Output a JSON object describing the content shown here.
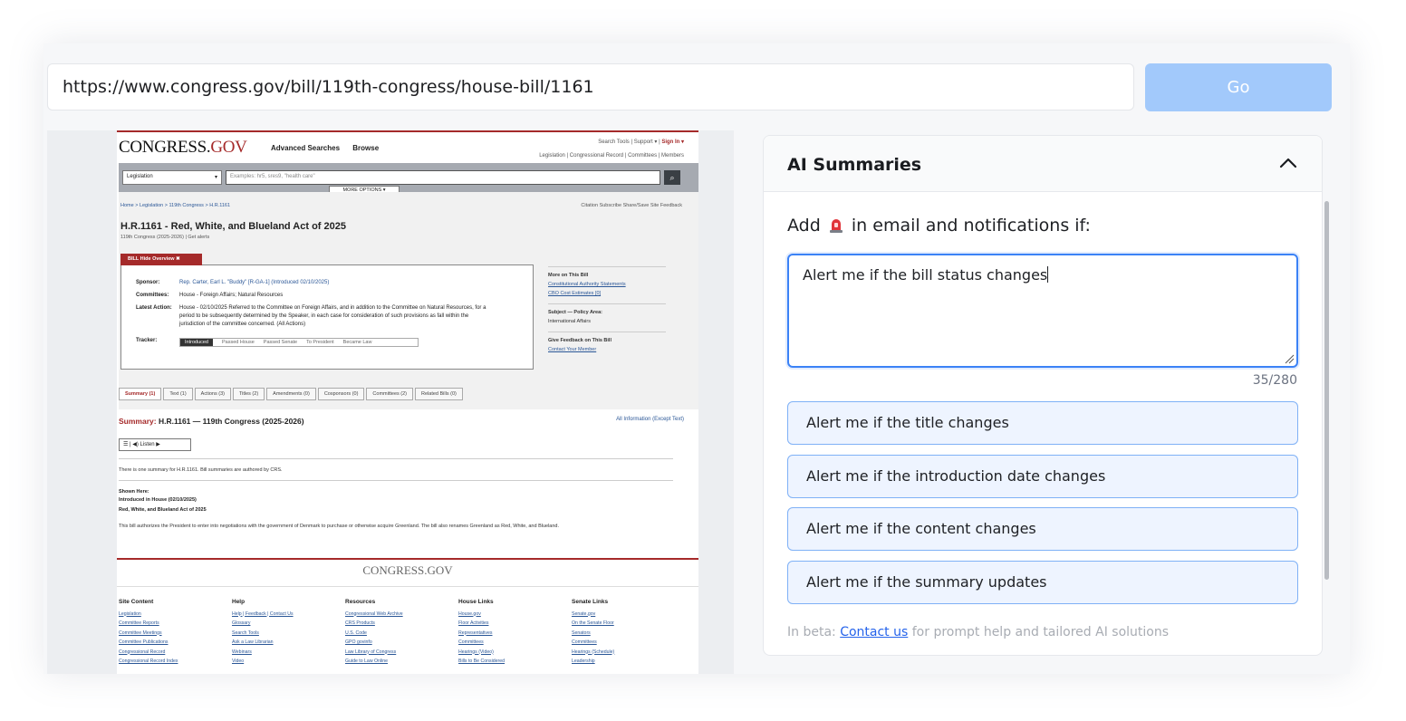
{
  "browser": {
    "url": "https://www.congress.gov/bill/119th-congress/house-bill/1161",
    "go_label": "Go"
  },
  "preview": {
    "logo": {
      "main": "CONGRESS.",
      "accent": "GOV"
    },
    "topnav": [
      "Advanced Searches",
      "Browse"
    ],
    "util_top": [
      "Search Tools",
      "Support ▾",
      "Sign In ▾"
    ],
    "util_bottom": [
      "Legislation",
      "Congressional Record",
      "Committees",
      "Members"
    ],
    "search_select": "Legislation",
    "search_placeholder": "Examples: hr5, sres9, \"health care\"",
    "more_options": "MORE OPTIONS ▾",
    "breadcrumb": "Home > Legislation > 119th Congress > H.R.1161",
    "tools": "Citation   Subscribe   Share/Save   Site Feedback",
    "bill_title": "H.R.1161 - Red, White, and Blueland Act of 2025",
    "bill_sub": "119th Congress (2025-2026) | Get alerts",
    "bill_tag": "BILL    Hide Overview ✖",
    "sponsor_label": "Sponsor:",
    "sponsor": "Rep. Carter, Earl L. \"Buddy\" [R-GA-1] (Introduced 02/10/2025)",
    "committees_label": "Committees:",
    "committees": "House - Foreign Affairs; Natural Resources",
    "latest_label": "Latest Action:",
    "latest_1": "House - 02/10/2025 Referred to the Committee on Foreign Affairs, and in addition to the Committee on Natural Resources, for a",
    "latest_2": "period to be subsequently determined by the Speaker, in each case for consideration of such provisions as fall within the",
    "latest_3": "jurisdiction of the committee concerned.  (All Actions)",
    "tracker_label": "Tracker:",
    "tracker_steps": [
      "Introduced",
      "Passed House",
      "Passed Senate",
      "To President",
      "Became Law"
    ],
    "right_more": "More on This Bill",
    "right_link1": "Constitutional Authority Statements",
    "right_link2": "CBO Cost Estimates [0]",
    "right_subject": "Subject — Policy Area:",
    "right_subject_val": "International Affairs",
    "right_feedback": "Give Feedback on This Bill",
    "right_contact": "Contact Your Member",
    "tabs": [
      "Summary (1)",
      "Text (1)",
      "Actions (3)",
      "Titles (2)",
      "Amendments (0)",
      "Cosponsors (0)",
      "Committees (2)",
      "Related Bills (0)"
    ],
    "summary_label": "Summary:",
    "summary_title": "H.R.1161 — 119th Congress (2025-2026)",
    "all_info": "All Information (Except Text)",
    "listen": "☰ | ◀) Listen  ▶",
    "one_summary": "There is one summary for H.R.1161. Bill summaries are authored by CRS.",
    "shown_here": "Shown Here:",
    "introduced": "Introduced in House (02/10/2025)",
    "act_name": "Red, White, and Blueland Act of 2025",
    "summary_text": "This bill authorizes the President to enter into negotiations with the government of Denmark to purchase or otherwise acquire Greenland. The bill also renames Greenland as Red, White, and Blueland.",
    "footer_logo": "CONGRESS.GOV",
    "footer_cols": [
      {
        "title": "Site Content",
        "links": [
          "Legislation",
          "Committee Reports",
          "Committee Meetings",
          "Committee Publications",
          "Congressional Record",
          "Congressional Record Index"
        ]
      },
      {
        "title": "Help",
        "links": [
          "Help | Feedback | Contact Us",
          "Glossary",
          "Search Tools",
          "Ask a Law Librarian",
          "Webinars",
          "Video"
        ]
      },
      {
        "title": "Resources",
        "links": [
          "Congressional Web Archive",
          "CRS Products",
          "U.S. Code",
          "GPO govinfo",
          "Law Library of Congress",
          "Guide to Law Online"
        ]
      },
      {
        "title": "House Links",
        "links": [
          "House.gov",
          "Floor Activities",
          "Representatives",
          "Committees",
          "Hearings (Video)",
          "Bills to Be Considered"
        ]
      },
      {
        "title": "Senate Links",
        "links": [
          "Senate.gov",
          "On the Senate Floor",
          "Senators",
          "Committees",
          "Hearings (Schedule)",
          "Leadership"
        ]
      }
    ]
  },
  "panel": {
    "title": "AI Summaries",
    "prompt_before": "Add",
    "prompt_after": "in email and notifications if:",
    "textarea_value": "Alert me if the bill status changes",
    "counter": "35/280",
    "suggestions": [
      "Alert me if the title changes",
      "Alert me if the introduction date changes",
      "Alert me if the content changes",
      "Alert me if the summary updates"
    ],
    "beta_before": "In beta:",
    "beta_link": "Contact us",
    "beta_after": "for prompt help and tailored AI solutions"
  },
  "colors": {
    "accent": "#3b82f6",
    "go_button": "#a2c9fb",
    "suggestion_bg": "#eef4ff",
    "congress_red": "#a52a2a"
  },
  "icons": [
    "chevron-up-icon",
    "siren-icon",
    "search-icon",
    "resize-handle-icon"
  ]
}
